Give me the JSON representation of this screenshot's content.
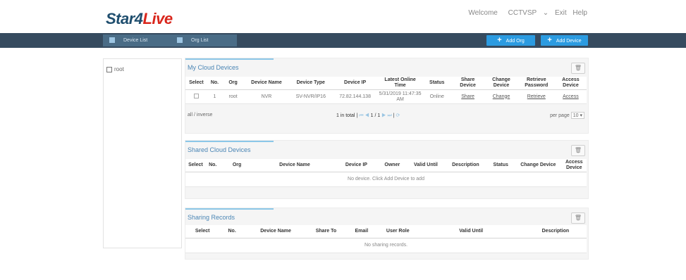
{
  "app": {
    "logo_part1": "Star4",
    "logo_part2": "Live",
    "welcome": "Welcome",
    "user": "CCTVSP",
    "exit": "Exit",
    "help": "Help"
  },
  "nav": {
    "device_list": "Device List",
    "org_list": "Org List",
    "add_org": "Add Org",
    "add_device": "Add Device"
  },
  "tree": {
    "root": "root"
  },
  "my_devices": {
    "title": "My Cloud Devices",
    "columns": [
      "Select",
      "No.",
      "Org",
      "Device Name",
      "Device Type",
      "Device IP",
      "Latest Online Time",
      "Status",
      "Share Device",
      "Change Device",
      "Retrieve Password",
      "Access Device"
    ],
    "rows": [
      {
        "no": "1",
        "org": "root",
        "name": "NVR",
        "type": "SV-NVR/IP16",
        "ip": "72.82.144.138",
        "time": "5/31/2019 11:47:35 AM",
        "status": "Online",
        "share": "Share",
        "change": "Change",
        "retrieve": "Retrieve",
        "access": "Access"
      }
    ],
    "all_inverse": "all / inverse",
    "total": "1 in total",
    "page": "1 / 1",
    "per_page": "per page",
    "per_page_value": "10"
  },
  "shared_devices": {
    "title": "Shared Cloud Devices",
    "columns": [
      "Select",
      "No.",
      "Org",
      "Device Name",
      "Device IP",
      "Owner",
      "Valid Until",
      "Description",
      "Status",
      "Change Device",
      "Access Device"
    ],
    "empty": "No device. Click Add Device to add"
  },
  "sharing_records": {
    "title": "Sharing Records",
    "columns": [
      "Select",
      "No.",
      "Device Name",
      "Share To",
      "Email",
      "User Role",
      "Valid Until",
      "Description"
    ],
    "empty": "No sharing records."
  },
  "colors": {
    "navbar": "#364b5f",
    "accent": "#2b9be1",
    "title_blue": "#4b86b5",
    "logo_dark": "#1f4e6e",
    "logo_red": "#d9261c"
  }
}
